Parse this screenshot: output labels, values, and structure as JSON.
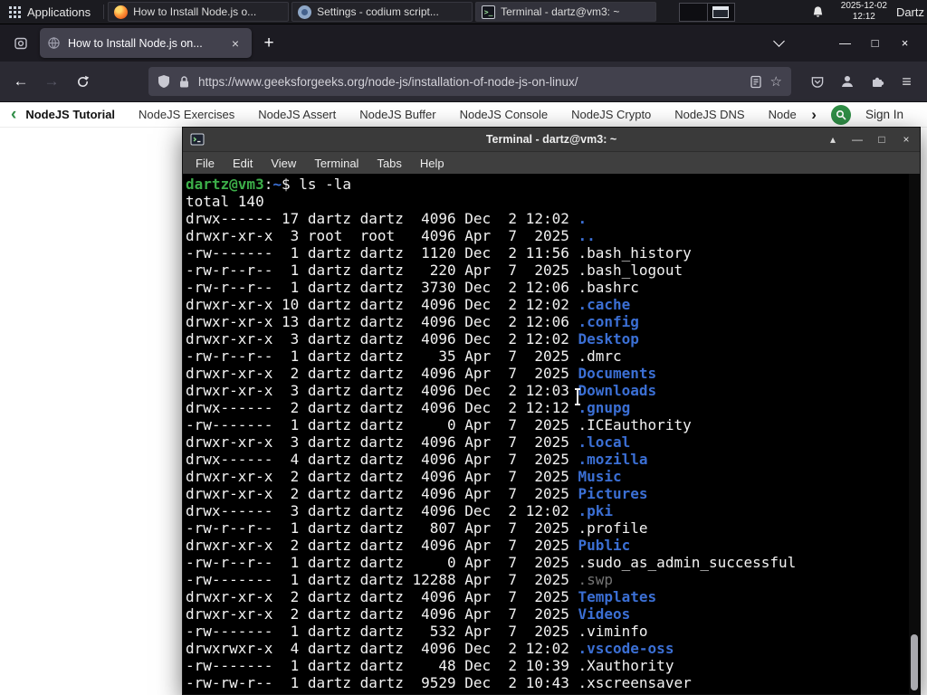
{
  "colors": {
    "gfg_green": "#2f8d46",
    "term_green": "#3cae49",
    "term_blue": "#3b6fd4",
    "term_dim": "#757575",
    "term_fg": "#f2f2f2"
  },
  "glyphs": {
    "back": "←",
    "forward": "→",
    "new_tab": "+",
    "close": "×",
    "minimize": "—",
    "maximize": "□",
    "shade": "▴",
    "star": "☆",
    "menu": "≡",
    "nav_back": "‹",
    "nav_forward": "›"
  },
  "icons": {
    "applications": "grid",
    "firefox_view": "rounded-square",
    "tab_favicon": "globe",
    "reload": "circular-arrow",
    "tracking_protection": "shield",
    "site_security": "lock",
    "reader_mode": "page-lines",
    "bookmark": "star",
    "pocket": "pocket-chevron",
    "account": "person",
    "extensions": "puzzle",
    "app_menu": "hamburger",
    "gfg_search": "magnifier",
    "notification": "bell",
    "terminal_app": "terminal-screen",
    "all_tabs": "chevron-down"
  },
  "panel": {
    "applications_label": "Applications",
    "tasks": [
      {
        "icon": "firefox",
        "label": "How to Install Node.js o...",
        "active": false
      },
      {
        "icon": "settings",
        "label": "Settings - codium script...",
        "active": false
      },
      {
        "icon": "terminal",
        "label": "Terminal - dartz@vm3: ~",
        "active": true
      }
    ],
    "clock_date": "2025-12-02",
    "clock_time": "12:12",
    "user_label": "Dartz"
  },
  "browser": {
    "tab_title": "How to Install Node.js on...",
    "url": "https://www.geeksforgeeks.org/node-js/installation-of-node-js-on-linux/"
  },
  "gfg": {
    "nav_items": [
      "NodeJS Tutorial",
      "NodeJS Exercises",
      "NodeJS Assert",
      "NodeJS Buffer",
      "NodeJS Console",
      "NodeJS Crypto",
      "NodeJS DNS",
      "Node"
    ],
    "sign_in_label": "Sign In"
  },
  "terminal": {
    "window_title": "Terminal - dartz@vm3: ~",
    "menu_items": [
      "File",
      "Edit",
      "View",
      "Terminal",
      "Tabs",
      "Help"
    ],
    "prompt_user_host": "dartz@vm3",
    "prompt_separator": ":",
    "prompt_path": "~",
    "prompt_symbol": "$ ",
    "command": "ls -la",
    "lines": [
      {
        "pre": "total 140",
        "name": "",
        "type": "plain"
      },
      {
        "pre": "drwx------ 17 dartz dartz  4096 Dec  2 12:02 ",
        "name": ".",
        "type": "dir"
      },
      {
        "pre": "drwxr-xr-x  3 root  root   4096 Apr  7  2025 ",
        "name": "..",
        "type": "dir"
      },
      {
        "pre": "-rw-------  1 dartz dartz  1120 Dec  2 11:56 ",
        "name": ".bash_history",
        "type": "plain"
      },
      {
        "pre": "-rw-r--r--  1 dartz dartz   220 Apr  7  2025 ",
        "name": ".bash_logout",
        "type": "plain"
      },
      {
        "pre": "-rw-r--r--  1 dartz dartz  3730 Dec  2 12:06 ",
        "name": ".bashrc",
        "type": "plain"
      },
      {
        "pre": "drwxr-xr-x 10 dartz dartz  4096 Dec  2 12:02 ",
        "name": ".cache",
        "type": "dir"
      },
      {
        "pre": "drwxr-xr-x 13 dartz dartz  4096 Dec  2 12:06 ",
        "name": ".config",
        "type": "dir"
      },
      {
        "pre": "drwxr-xr-x  3 dartz dartz  4096 Dec  2 12:02 ",
        "name": "Desktop",
        "type": "dir"
      },
      {
        "pre": "-rw-r--r--  1 dartz dartz    35 Apr  7  2025 ",
        "name": ".dmrc",
        "type": "plain"
      },
      {
        "pre": "drwxr-xr-x  2 dartz dartz  4096 Apr  7  2025 ",
        "name": "Documents",
        "type": "dir"
      },
      {
        "pre": "drwxr-xr-x  3 dartz dartz  4096 Dec  2 12:03 ",
        "name": "Downloads",
        "type": "dir"
      },
      {
        "pre": "drwx------  2 dartz dartz  4096 Dec  2 12:12 ",
        "name": ".gnupg",
        "type": "dir"
      },
      {
        "pre": "-rw-------  1 dartz dartz     0 Apr  7  2025 ",
        "name": ".ICEauthority",
        "type": "plain"
      },
      {
        "pre": "drwxr-xr-x  3 dartz dartz  4096 Apr  7  2025 ",
        "name": ".local",
        "type": "dir"
      },
      {
        "pre": "drwx------  4 dartz dartz  4096 Apr  7  2025 ",
        "name": ".mozilla",
        "type": "dir"
      },
      {
        "pre": "drwxr-xr-x  2 dartz dartz  4096 Apr  7  2025 ",
        "name": "Music",
        "type": "dir"
      },
      {
        "pre": "drwxr-xr-x  2 dartz dartz  4096 Apr  7  2025 ",
        "name": "Pictures",
        "type": "dir"
      },
      {
        "pre": "drwx------  3 dartz dartz  4096 Dec  2 12:02 ",
        "name": ".pki",
        "type": "dir"
      },
      {
        "pre": "-rw-r--r--  1 dartz dartz   807 Apr  7  2025 ",
        "name": ".profile",
        "type": "plain"
      },
      {
        "pre": "drwxr-xr-x  2 dartz dartz  4096 Apr  7  2025 ",
        "name": "Public",
        "type": "dir"
      },
      {
        "pre": "-rw-r--r--  1 dartz dartz     0 Apr  7  2025 ",
        "name": ".sudo_as_admin_successful",
        "type": "plain"
      },
      {
        "pre": "-rw-------  1 dartz dartz 12288 Apr  7  2025 ",
        "name": ".swp",
        "type": "dim"
      },
      {
        "pre": "drwxr-xr-x  2 dartz dartz  4096 Apr  7  2025 ",
        "name": "Templates",
        "type": "dir"
      },
      {
        "pre": "drwxr-xr-x  2 dartz dartz  4096 Apr  7  2025 ",
        "name": "Videos",
        "type": "dir"
      },
      {
        "pre": "-rw-------  1 dartz dartz   532 Apr  7  2025 ",
        "name": ".viminfo",
        "type": "plain"
      },
      {
        "pre": "drwxrwxr-x  4 dartz dartz  4096 Dec  2 12:02 ",
        "name": ".vscode-oss",
        "type": "dir"
      },
      {
        "pre": "-rw-------  1 dartz dartz    48 Dec  2 10:39 ",
        "name": ".Xauthority",
        "type": "plain"
      },
      {
        "pre": "-rw-rw-r--  1 dartz dartz  9529 Dec  2 10:43 ",
        "name": ".xscreensaver",
        "type": "plain"
      }
    ]
  }
}
